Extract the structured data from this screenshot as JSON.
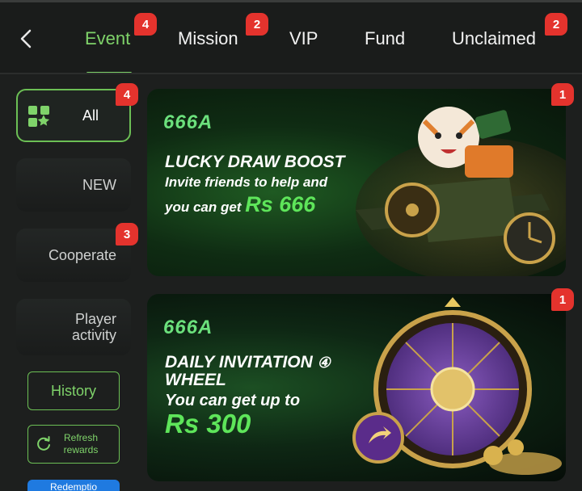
{
  "nav": {
    "back_icon": "chevron-left-icon",
    "tabs": [
      {
        "label": "Event",
        "badge": "4",
        "active": true
      },
      {
        "label": "Mission",
        "badge": "2",
        "active": false
      },
      {
        "label": "VIP",
        "badge": "",
        "active": false
      },
      {
        "label": "Fund",
        "badge": "",
        "active": false
      },
      {
        "label": "Unclaimed",
        "badge": "2",
        "active": false
      }
    ]
  },
  "sidebar": {
    "items": [
      {
        "label": "All",
        "badge": "4",
        "icon": "grid-icon",
        "active": true
      },
      {
        "label": "NEW",
        "badge": ""
      },
      {
        "label": "Cooperate",
        "badge": "3"
      },
      {
        "label": "Player activity",
        "badge": ""
      }
    ],
    "history_label": "History",
    "refresh_label": "Refresh rewards",
    "redemption_label": "Redemptio"
  },
  "banners": [
    {
      "badge": "1",
      "logo": "666A",
      "title": "LUCKY DRAW BOOST",
      "line2": "Invite friends to help and",
      "line3_prefix": "you can get",
      "amount": "Rs 666"
    },
    {
      "badge": "1",
      "logo": "666A",
      "title_line1": "DAILY INVITATION",
      "title_mark": "④",
      "title_line2": "WHEEL",
      "subtitle": "You can get up to",
      "amount": "Rs 300"
    }
  ],
  "colors": {
    "accent": "#7fd36a",
    "badge": "#e4332d",
    "background": "#1d1f1e"
  }
}
